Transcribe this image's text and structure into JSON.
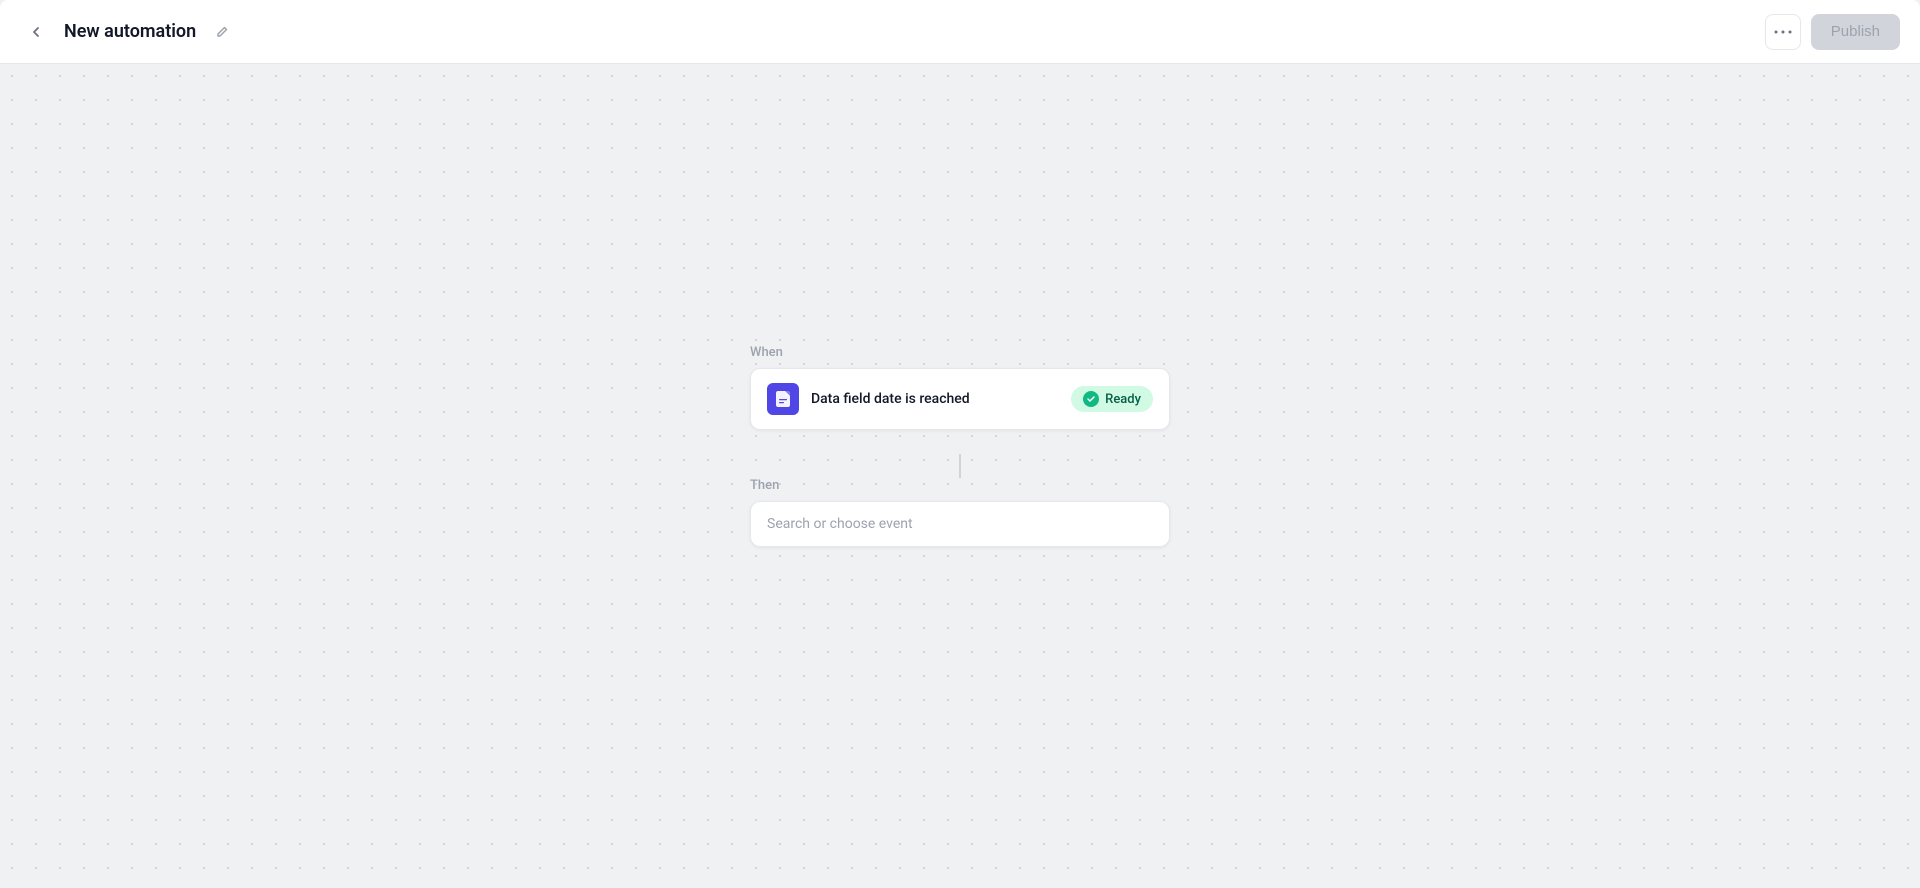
{
  "header": {
    "back_label": "←",
    "title": "New automation",
    "edit_icon": "✏",
    "more_icon": "···",
    "publish_label": "Publish"
  },
  "canvas": {
    "when_label": "When",
    "then_label": "Then",
    "trigger": {
      "label": "Data field date is reached",
      "icon": "📄",
      "status": "Ready"
    },
    "action": {
      "placeholder": "Search or choose event"
    }
  }
}
